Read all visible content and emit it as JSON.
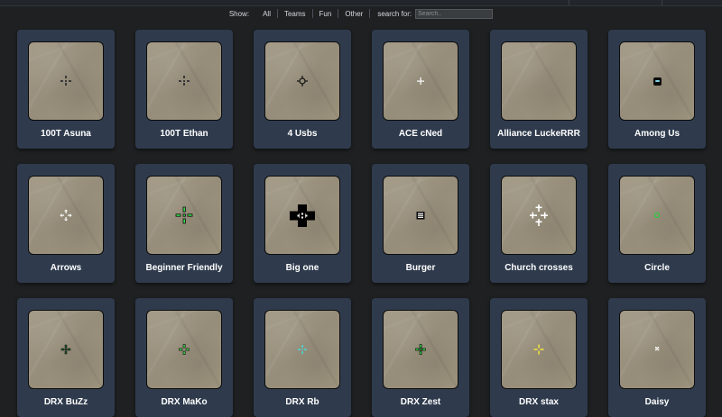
{
  "filters": {
    "show_label": "Show:",
    "options": [
      "All",
      "Teams",
      "Fun",
      "Other"
    ],
    "search_label": "search for:",
    "search_placeholder": "Search.."
  },
  "cards": [
    {
      "title": "100T Asuna",
      "icon": "crosshair-dark-plus-dot-icon"
    },
    {
      "title": "100T Ethan",
      "icon": "crosshair-dark-plus-dot-icon"
    },
    {
      "title": "4 Usbs",
      "icon": "crosshair-black-circle-plus-icon"
    },
    {
      "title": "ACE cNed",
      "icon": "crosshair-white-plus-icon"
    },
    {
      "title": "Alliance LuckeRRR",
      "icon": "crosshair-empty-icon"
    },
    {
      "title": "Among Us",
      "icon": "crosshair-among-us-icon"
    },
    {
      "title": "Arrows",
      "icon": "crosshair-white-arrows-icon"
    },
    {
      "title": "Beginner Friendly",
      "icon": "crosshair-green-outline-plus-icon"
    },
    {
      "title": "Big one",
      "icon": "crosshair-big-black-plus-icon"
    },
    {
      "title": "Burger",
      "icon": "crosshair-burger-icon"
    },
    {
      "title": "Church crosses",
      "icon": "crosshair-white-crosses-icon"
    },
    {
      "title": "Circle",
      "icon": "crosshair-green-circle-icon"
    },
    {
      "title": "DRX BuZz",
      "icon": "crosshair-dark-green-plus-icon"
    },
    {
      "title": "DRX MaKo",
      "icon": "crosshair-green-plus-icon"
    },
    {
      "title": "DRX Rb",
      "icon": "crosshair-cyan-plus-icon"
    },
    {
      "title": "DRX Zest",
      "icon": "crosshair-green-plus-icon"
    },
    {
      "title": "DRX stax",
      "icon": "crosshair-yellow-plus-icon"
    },
    {
      "title": "Daisy",
      "icon": "crosshair-white-flower-icon"
    }
  ]
}
